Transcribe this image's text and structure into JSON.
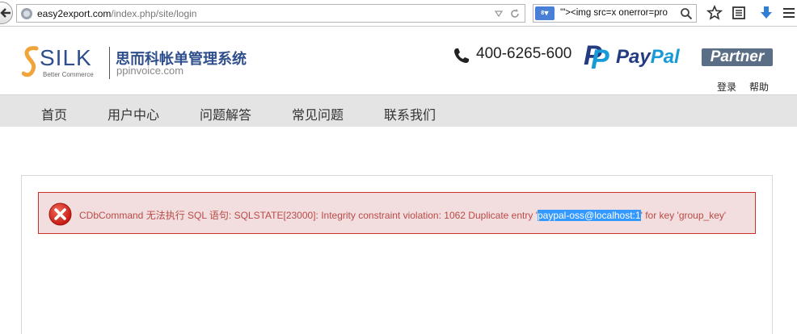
{
  "browser": {
    "url_host": "easy2export.com",
    "url_path": "/index.php/site/login",
    "search_engine_badge": "8",
    "search_text": "'\"><img src=x onerror=pro"
  },
  "header": {
    "logo_word": "SILK",
    "logo_tagline": "Better Commerce",
    "brand_cn": "思而科帐单管理系统",
    "brand_en": "ppinvoice.com",
    "phone": "400-6265-600",
    "paypal_word_1": "Pay",
    "paypal_word_2": "Pal",
    "paypal_partner": "Partner",
    "links": [
      "登录",
      "帮助"
    ]
  },
  "nav": {
    "items": [
      "首页",
      "用户中心",
      "问题解答",
      "常见问题",
      "联系我们"
    ]
  },
  "error": {
    "text_before": "CDbCommand 无法执行 SQL 语句: SQLSTATE[23000]: Integrity constraint violation: 1062 Duplicate entry '",
    "highlighted": "paypal-oss@localhost:1",
    "text_after": "' for key 'group_key'"
  },
  "colors": {
    "nav_bg": "#e4e4e4",
    "error_bg": "#f2dede",
    "error_text": "#b94a48",
    "brand_blue": "#2f4f8c",
    "paypal_dark": "#253b80",
    "paypal_light": "#179bd7"
  },
  "icons": [
    "back-arrow-icon",
    "globe-icon",
    "bookmark-star-icon",
    "search-icon",
    "reading-list-icon",
    "download-icon",
    "phone-icon",
    "paypal-logo",
    "error-x-icon"
  ]
}
